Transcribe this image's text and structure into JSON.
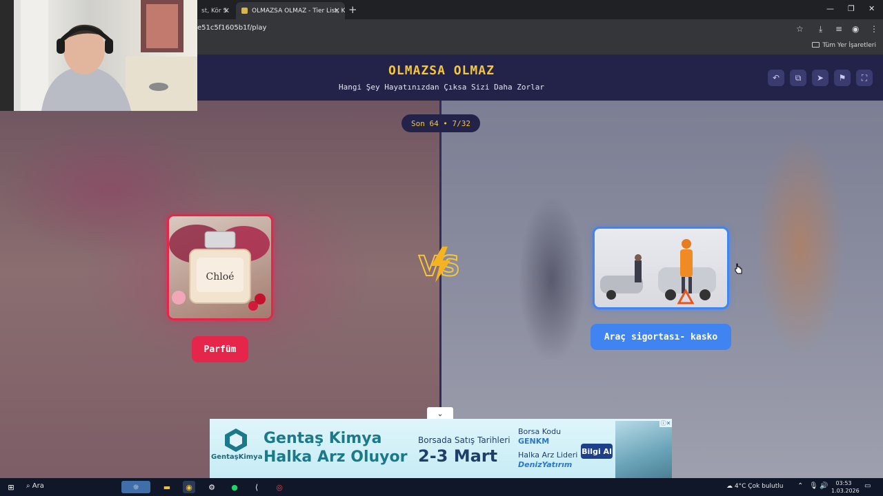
{
  "browser": {
    "tabs": [
      {
        "label": "st, Kör S"
      },
      {
        "label": "OLMAZSA OLMAZ - Tier List, K"
      }
    ],
    "url": "e51c5f1605b1f/play",
    "bookmarks_label": "Tüm Yer İşaretleri"
  },
  "game": {
    "title": "OLMAZSA OLMAZ",
    "subtitle": "Hangi Şey Hayatınızdan Çıksa Sizi Daha Zorlar",
    "progress": "Son 64 • 7/32",
    "vs_label": "VS",
    "left_option": {
      "label": "Parfüm",
      "image_text": "Chloé",
      "accent": "#e5264a"
    },
    "right_option": {
      "label": "Araç sigortası- kasko",
      "accent": "#3f84f1"
    },
    "header_icons": [
      "undo-icon",
      "share-icon",
      "send-icon",
      "flag-icon",
      "fullscreen-icon"
    ]
  },
  "ad": {
    "brand": "Gentaş Kimya",
    "logo_text": "GentaşKimya",
    "headline1": "Gentaş Kimya",
    "headline2": "Halka Arz Oluyor",
    "dates_label": "Borsada Satış Tarihleri",
    "dates": "2-3 Mart",
    "ticker_label": "Borsa Kodu",
    "ticker": "GENKM",
    "leader_label": "Halka Arz Lideri",
    "leader": "DenizYatırım",
    "cta": "Bilgi Al"
  },
  "taskbar": {
    "search_placeholder": "Ara",
    "weather": "4°C  Çok bulutlu",
    "time": "03:53",
    "date": "1.03.2026"
  }
}
